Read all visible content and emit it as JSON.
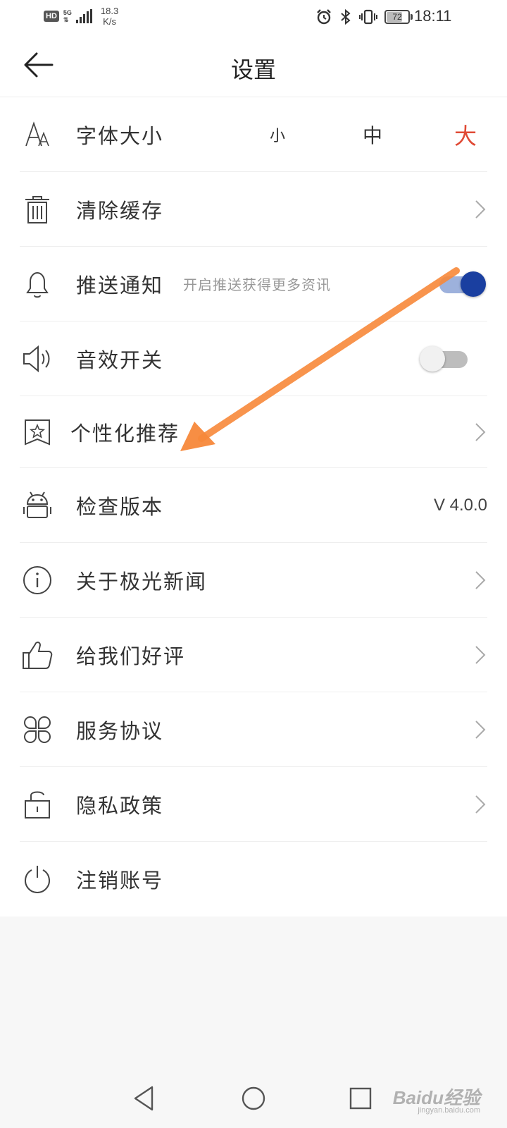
{
  "status_bar": {
    "hd": "HD",
    "network": "5G",
    "speed_value": "18.3",
    "speed_unit": "K/s",
    "battery": "72",
    "time": "18:11"
  },
  "header": {
    "title": "设置"
  },
  "settings": {
    "font_size": {
      "label": "字体大小",
      "options": [
        "小",
        "中",
        "大"
      ],
      "selected": "大"
    },
    "clear_cache": {
      "label": "清除缓存"
    },
    "push_notify": {
      "label": "推送通知",
      "hint": "开启推送获得更多资讯",
      "enabled": true
    },
    "sound": {
      "label": "音效开关",
      "enabled": false
    },
    "personalized": {
      "label": "个性化推荐"
    },
    "check_version": {
      "label": "检查版本",
      "value": "V 4.0.0"
    },
    "about": {
      "label": "关于极光新闻"
    },
    "rate": {
      "label": "给我们好评"
    },
    "agreement": {
      "label": "服务协议"
    },
    "privacy": {
      "label": "隐私政策"
    },
    "logout": {
      "label": "注销账号"
    }
  },
  "watermark": {
    "main": "Baidu经验",
    "sub": "jingyan.baidu.com"
  },
  "colors": {
    "accent_red": "#e04a35",
    "toggle_on": "#1a3fa0",
    "annotation_arrow": "#f7883a"
  }
}
